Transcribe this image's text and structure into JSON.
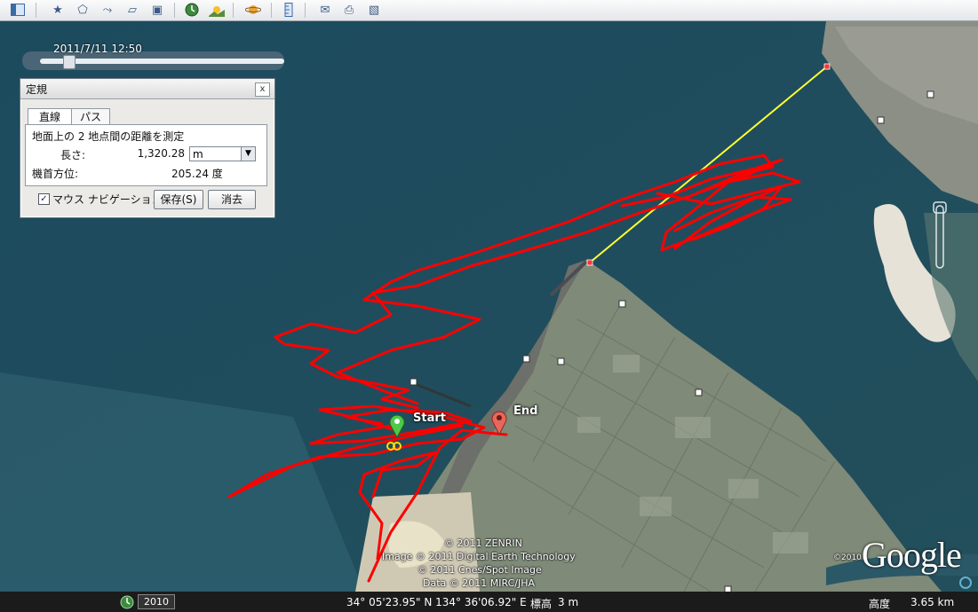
{
  "toolbar": {
    "buttons": [
      {
        "icon": "sidebar-icon"
      },
      {
        "icon": "placemark-icon"
      },
      {
        "icon": "polygon-icon"
      },
      {
        "icon": "path-icon"
      },
      {
        "icon": "overlay-icon"
      },
      {
        "icon": "tour-icon"
      },
      {
        "icon": "historical-imagery-icon"
      },
      {
        "icon": "sunlight-icon"
      },
      {
        "icon": "planet-icon"
      },
      {
        "icon": "ruler-icon"
      },
      {
        "icon": "email-icon"
      },
      {
        "icon": "print-icon"
      },
      {
        "icon": "save-image-icon"
      }
    ]
  },
  "timebar": {
    "label": "2011/7/11   12:50",
    "position": 0.1
  },
  "ruler_dialog": {
    "title": "定規",
    "close": "x",
    "tabs": [
      {
        "label": "直線",
        "active": true
      },
      {
        "label": "パス",
        "active": false
      }
    ],
    "description": "地面上の 2 地点間の距離を測定",
    "length_label": "長さ:",
    "length_value": "1,320.28",
    "unit": "m",
    "heading_label": "機首方位:",
    "heading_value": "205.24 度",
    "mouse_nav_label": "マウス ナビゲーション",
    "mouse_nav_checked": true,
    "save_button": "保存(S)",
    "clear_button": "消去"
  },
  "map": {
    "start_label": "Start",
    "end_label": "End",
    "track_color": "#ff0000",
    "ruler_line_color": "#ffff33",
    "start_pin_color": "#4fc84a",
    "end_pin_color": "#e8675d",
    "copyright": [
      "© 2011 ZENRIN",
      "Image © 2011 Digital Earth Technology",
      "© 2011 Cnes/Spot Image",
      "Data © 2011 MIRC/JHA"
    ],
    "logo": "Google",
    "logo_year": "©2010"
  },
  "status": {
    "year": "2010",
    "coordinates": "34° 05'23.95\" N 134° 36'06.92\" E",
    "elevation_label": "標高",
    "elevation": "3 m",
    "altitude_label": "高度",
    "altitude": "3.65 km"
  }
}
